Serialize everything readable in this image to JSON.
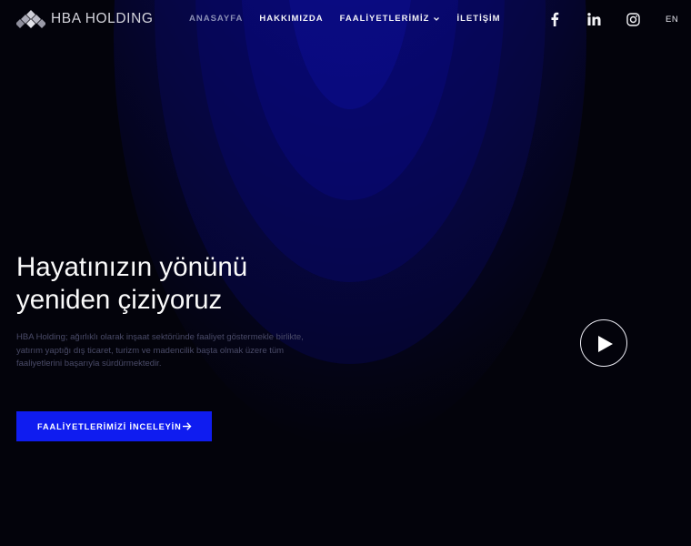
{
  "brand": {
    "name": "HBA HOLDING",
    "logo_icon": "diamond-logo-icon"
  },
  "nav": {
    "items": [
      {
        "label": "ANASAYFA",
        "active": true
      },
      {
        "label": "HAKKIMIZDA",
        "active": false
      },
      {
        "label": "FAALİYETLERİMİZ",
        "active": false,
        "has_dropdown": true
      },
      {
        "label": "İLETİŞİM",
        "active": false
      }
    ]
  },
  "social": [
    {
      "icon": "facebook-icon"
    },
    {
      "icon": "linkedin-icon"
    },
    {
      "icon": "instagram-icon"
    }
  ],
  "language": "EN",
  "hero": {
    "title_line1": "Hayatınızın yönünü",
    "title_line2": "yeniden çiziyoruz",
    "description": "HBA Holding; ağırlıklı olarak inşaat sektöründe faaliyet göstermekle birlikte, yatırım yaptığı dış ticaret, turizm ve madencilik başta olmak üzere tüm faaliyetlerini başarıyla sürdürmektedir.",
    "cta_label": "FAALİYETLERİMİZİ İNCELEYİN",
    "play_icon": "play-icon"
  },
  "colors": {
    "accent": "#0f1cf0",
    "background": "#03030b",
    "glow": "#0b0a7a"
  }
}
